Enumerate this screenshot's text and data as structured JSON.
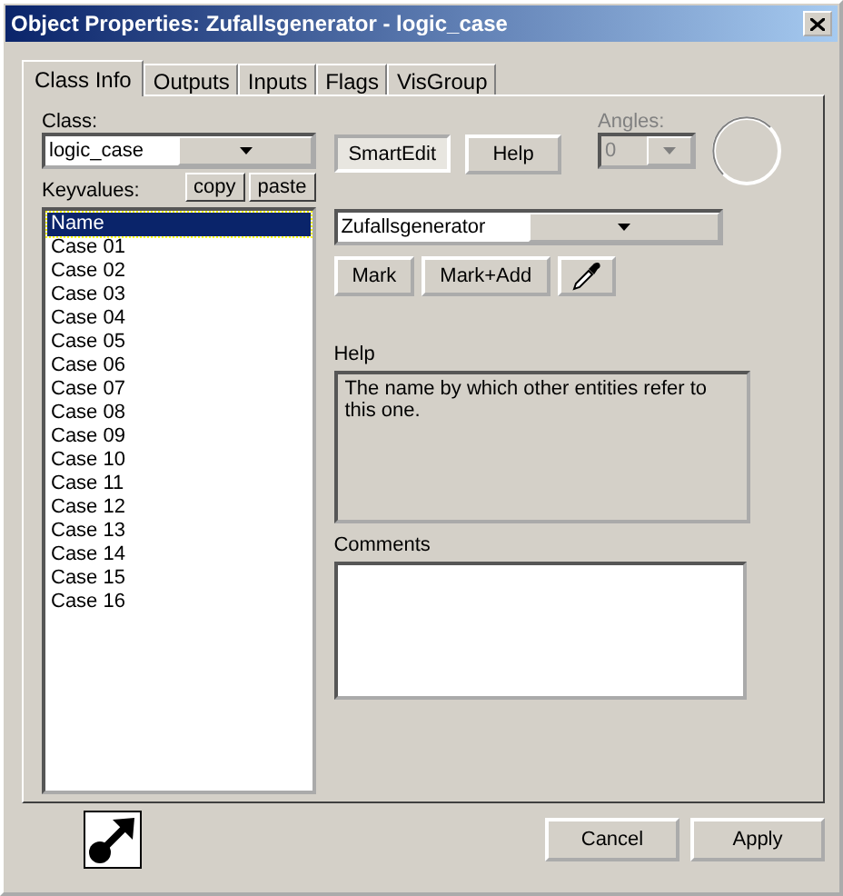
{
  "window": {
    "title": "Object Properties: Zufallsgenerator - logic_case"
  },
  "tabs": [
    {
      "label": "Class Info",
      "selected": true
    },
    {
      "label": "Outputs",
      "selected": false
    },
    {
      "label": "Inputs",
      "selected": false
    },
    {
      "label": "Flags",
      "selected": false
    },
    {
      "label": "VisGroup",
      "selected": false
    }
  ],
  "class_field": {
    "label": "Class:",
    "value": "logic_case"
  },
  "smart_edit": {
    "label": "SmartEdit",
    "pressed": true
  },
  "help_button": {
    "label": "Help"
  },
  "angles": {
    "label": "Angles:",
    "value": "0",
    "disabled": true
  },
  "keyvalues": {
    "label": "Keyvalues:",
    "copy": "copy",
    "paste": "paste",
    "items": [
      {
        "label": "Name",
        "selected": true
      },
      {
        "label": "Case 01",
        "selected": false
      },
      {
        "label": "Case 02",
        "selected": false
      },
      {
        "label": "Case 03",
        "selected": false
      },
      {
        "label": "Case 04",
        "selected": false
      },
      {
        "label": "Case 05",
        "selected": false
      },
      {
        "label": "Case 06",
        "selected": false
      },
      {
        "label": "Case 07",
        "selected": false
      },
      {
        "label": "Case 08",
        "selected": false
      },
      {
        "label": "Case 09",
        "selected": false
      },
      {
        "label": "Case 10",
        "selected": false
      },
      {
        "label": "Case 11",
        "selected": false
      },
      {
        "label": "Case 12",
        "selected": false
      },
      {
        "label": "Case 13",
        "selected": false
      },
      {
        "label": "Case 14",
        "selected": false
      },
      {
        "label": "Case 15",
        "selected": false
      },
      {
        "label": "Case 16",
        "selected": false
      }
    ]
  },
  "value_field": {
    "value": "Zufallsgenerator"
  },
  "mark_buttons": [
    "Mark",
    "Mark+Add"
  ],
  "help": {
    "label": "Help",
    "text": "The name by which other entities refer to this one."
  },
  "comments": {
    "label": "Comments"
  },
  "buttons": [
    "Cancel",
    "Apply"
  ]
}
